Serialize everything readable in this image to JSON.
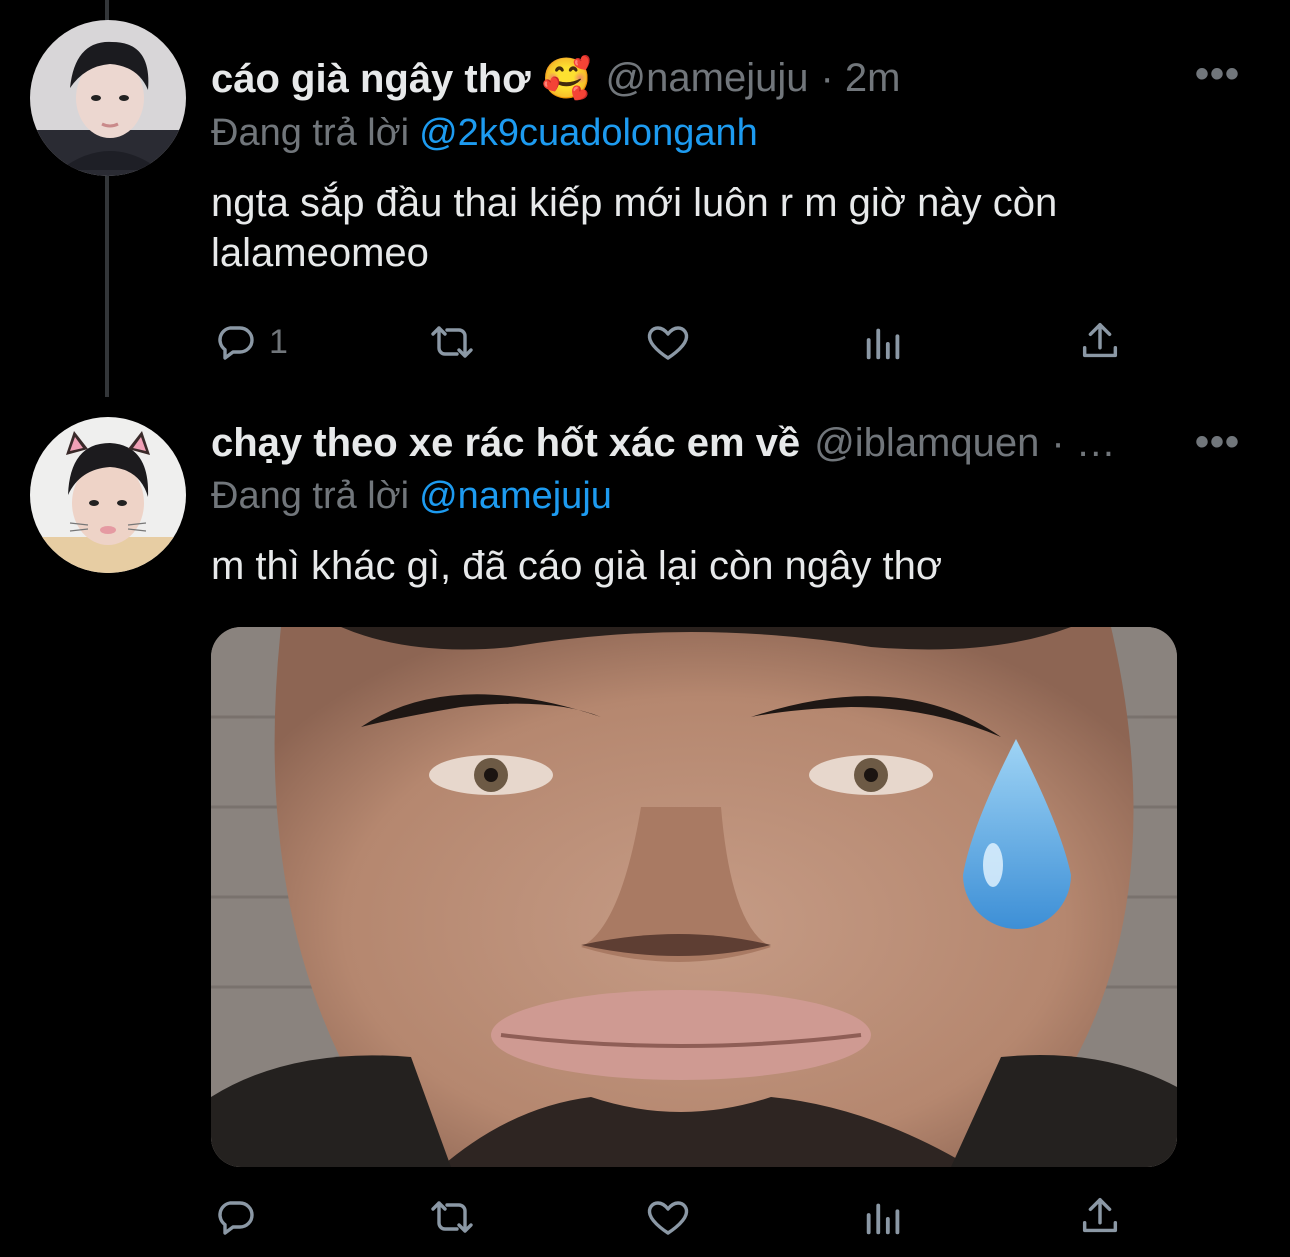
{
  "tweets": [
    {
      "name": "cáo già ngây thơ 🥰",
      "handle": "@namejuju",
      "time": "· 2m",
      "reply_prefix": "Đang trả lời",
      "reply_to": "@2k9cuadolonganh",
      "text": "ngta sắp đầu thai kiếp mới luôn r m giờ này còn lalameomeo",
      "reply_count": "1"
    },
    {
      "name": "chạy theo xe rác hốt xác em về",
      "handle": "@iblamquen",
      "time": "· …",
      "reply_prefix": "Đang trả lời",
      "reply_to": "@namejuju",
      "text": "m thì khác gì, đã cáo già lại còn ngây thơ",
      "reply_count": ""
    }
  ],
  "more_label": "•••",
  "icons": [
    "reply-icon",
    "retweet-icon",
    "like-icon",
    "analytics-icon",
    "share-icon",
    "more-icon"
  ],
  "colors": {
    "background": "#000000",
    "text": "#e7e9ea",
    "muted": "#71767b",
    "link": "#1d9bf0"
  }
}
